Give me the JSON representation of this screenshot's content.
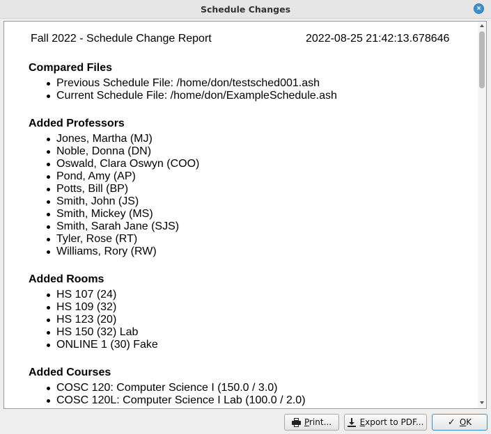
{
  "window": {
    "title": "Schedule Changes"
  },
  "report": {
    "title": "Fall 2022 - Schedule Change Report",
    "timestamp": "2022-08-25 21:42:13.678646",
    "sections": {
      "compared_files": {
        "heading": "Compared Files",
        "items": [
          "Previous Schedule File: /home/don/testsched001.ash",
          "Current Schedule File: /home/don/ExampleSchedule.ash"
        ]
      },
      "added_professors": {
        "heading": "Added Professors",
        "items": [
          "Jones, Martha (MJ)",
          "Noble, Donna (DN)",
          "Oswald, Clara Oswyn (COO)",
          "Pond, Amy (AP)",
          "Potts, Bill (BP)",
          "Smith, John (JS)",
          "Smith, Mickey (MS)",
          "Smith, Sarah Jane (SJS)",
          "Tyler, Rose (RT)",
          "Williams, Rory (RW)"
        ]
      },
      "added_rooms": {
        "heading": "Added Rooms",
        "items": [
          "HS 107 (24)",
          "HS 109 (32)",
          "HS 123 (20)",
          "HS 150 (32) Lab",
          "ONLINE 1 (30) Fake"
        ]
      },
      "added_courses": {
        "heading": "Added Courses",
        "items": [
          "COSC 120: Computer Science I (150.0 / 3.0)",
          "COSC 120L: Computer Science I Lab (100.0 / 2.0)"
        ]
      }
    }
  },
  "buttons": {
    "print": "Print...",
    "export": "Export to PDF...",
    "ok": "OK"
  },
  "icons": {
    "close": "close-icon",
    "print": "printer-icon",
    "export": "download-icon",
    "ok": "checkmark-icon"
  },
  "colors": {
    "accent": "#3d8fd0"
  }
}
